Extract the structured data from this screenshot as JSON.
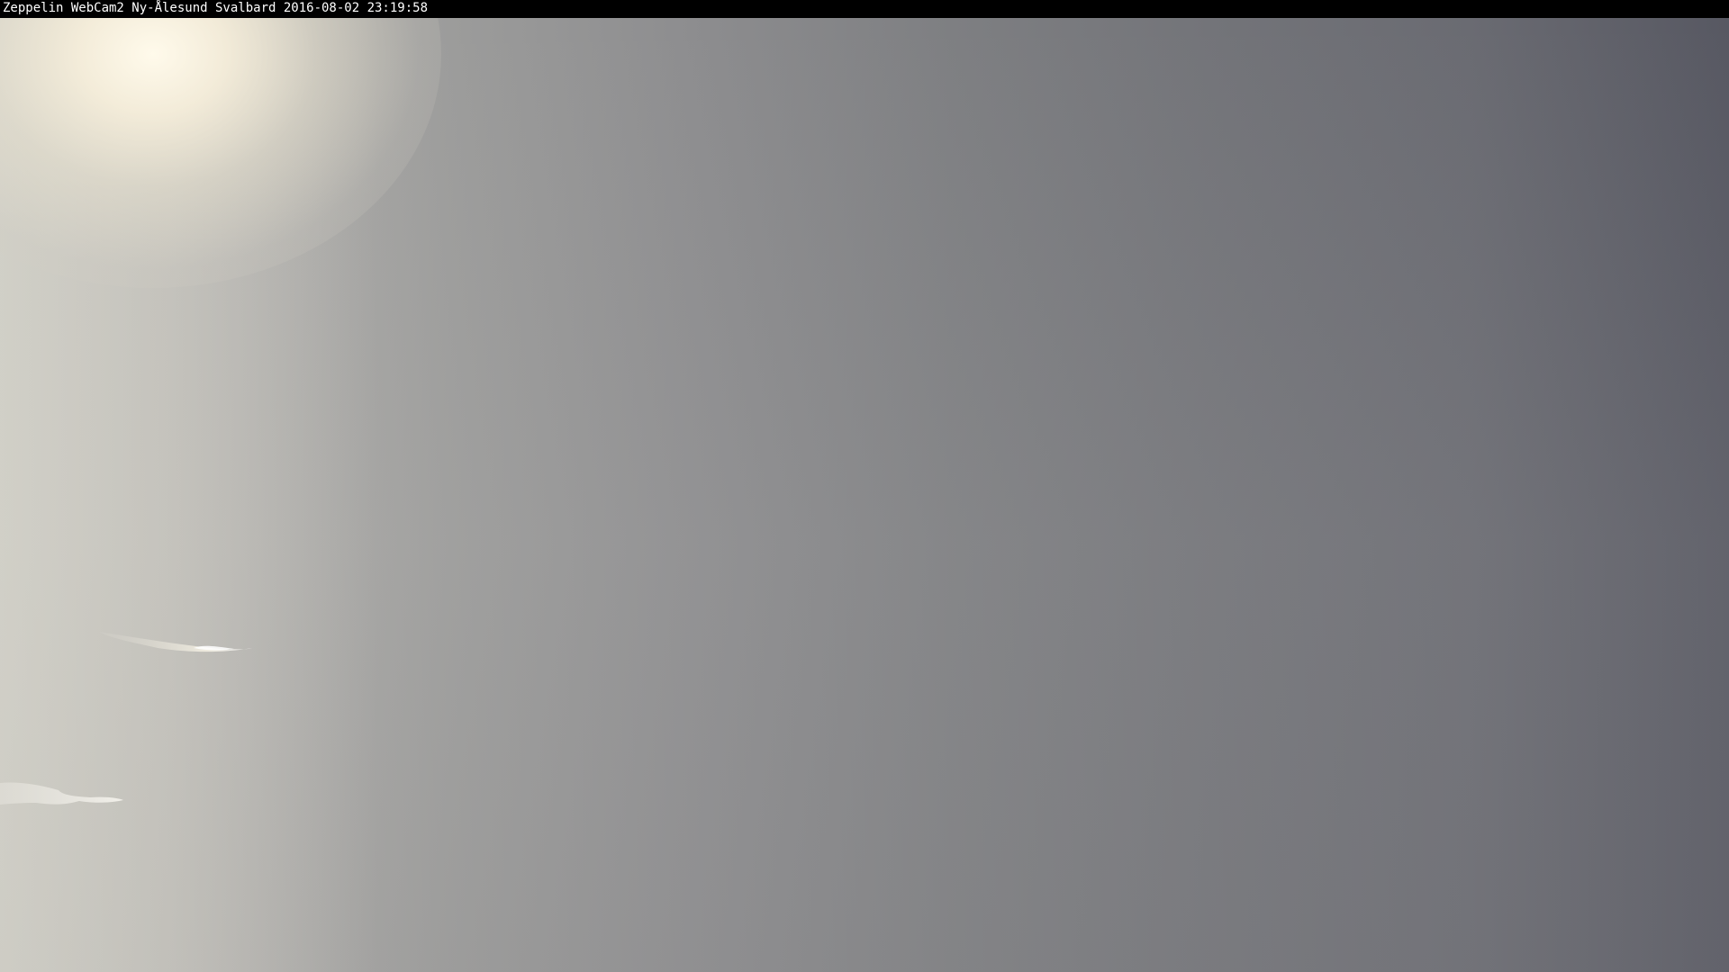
{
  "caption": {
    "text": "Zeppelin WebCam2 Ny-Ålesund Svalbard 2016-08-02 23:19:58"
  },
  "scene": {
    "description_colors": {
      "fog_left": "#bfbeb7",
      "fog_right": "#575862",
      "sun": "#fffaeb"
    }
  }
}
